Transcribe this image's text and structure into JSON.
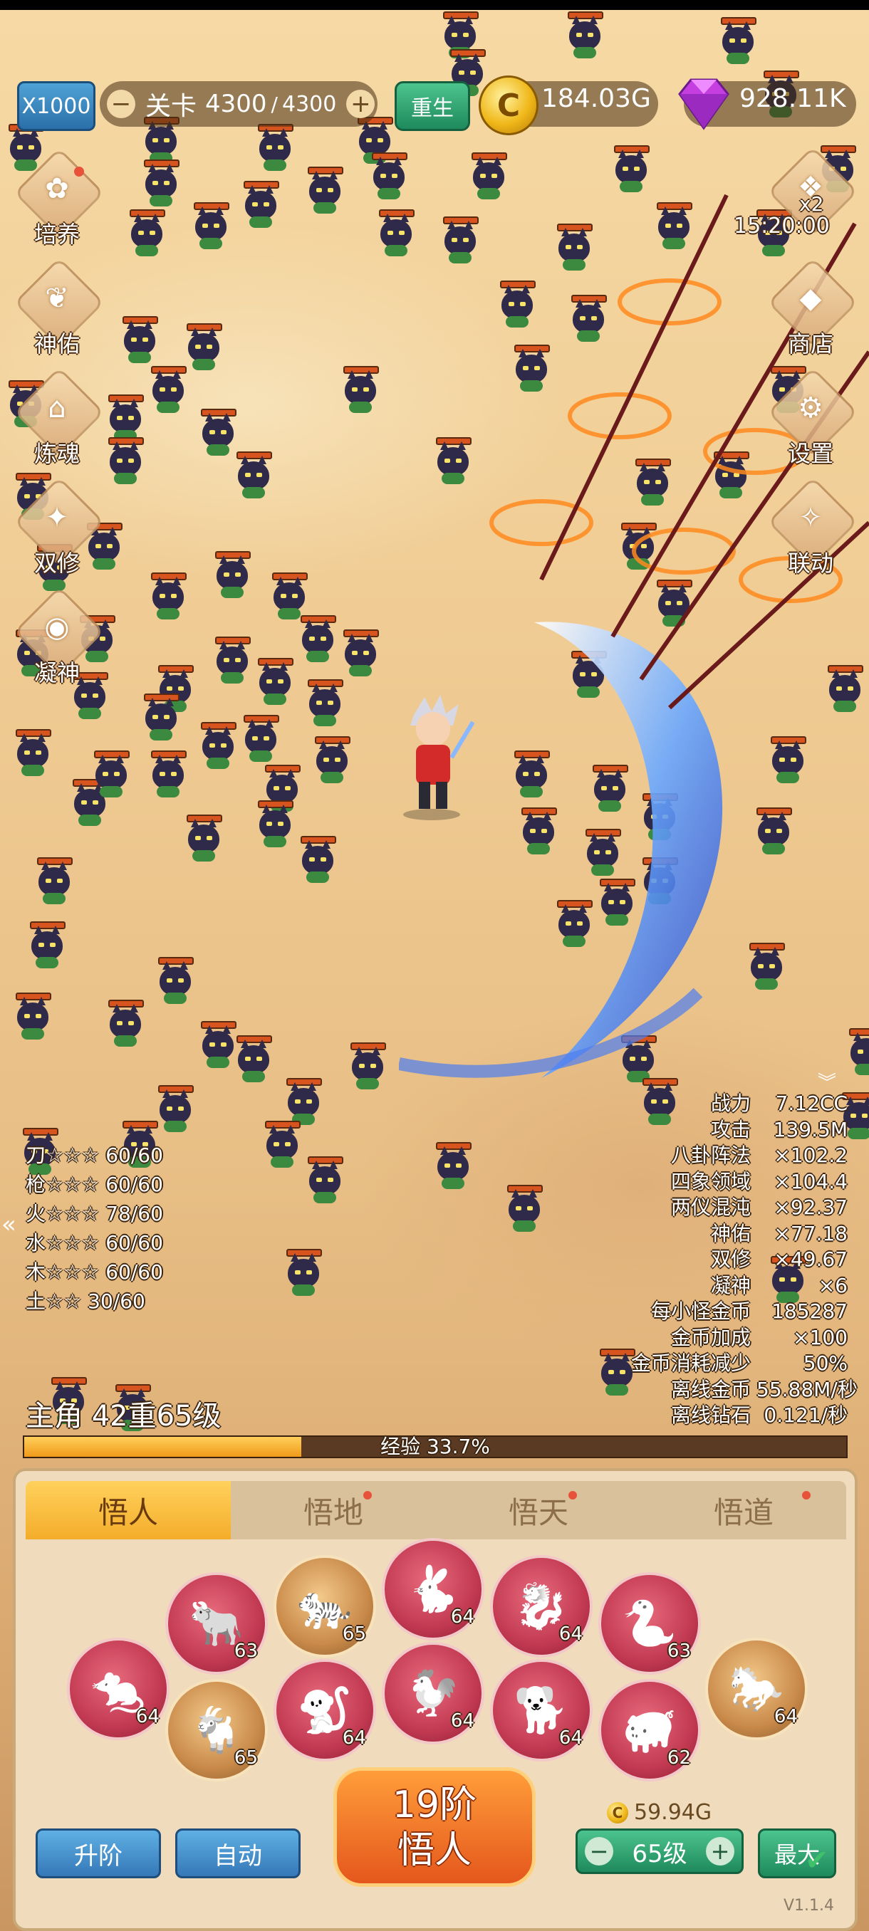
{
  "hud": {
    "speed": "X1000",
    "stage_label": "关卡",
    "stage_current": "4300",
    "stage_sep": "/",
    "stage_max": "4300",
    "minus": "−",
    "plus": "+",
    "rebirth": "重生",
    "gold": "184.03G",
    "gold_coin": "C",
    "gems": "928.11K"
  },
  "side_left": [
    {
      "label": "培养",
      "icon": "flower-icon",
      "glyph": "✿"
    },
    {
      "label": "神佑",
      "icon": "wing-icon",
      "glyph": "❦"
    },
    {
      "label": "炼魂",
      "icon": "house-icon",
      "glyph": "⌂"
    },
    {
      "label": "双修",
      "icon": "flame-icon",
      "glyph": "✦"
    },
    {
      "label": "凝神",
      "icon": "eye-icon",
      "glyph": "◉"
    }
  ],
  "side_right": [
    {
      "label": "x2",
      "icon": "bag-icon"
    },
    {
      "label": "商店",
      "icon": "gem-shop-icon",
      "glyph": "◆"
    },
    {
      "label": "设置",
      "icon": "gear-icon",
      "glyph": "⚙"
    },
    {
      "label": "联动",
      "icon": "link-icon",
      "glyph": "✧"
    }
  ],
  "timer": "15:20:00",
  "elements": [
    {
      "name": "刀",
      "stars": "☆☆☆",
      "value": "60/60"
    },
    {
      "name": "枪",
      "stars": "☆☆☆",
      "value": "60/60"
    },
    {
      "name": "火",
      "stars": "☆☆☆",
      "value": "78/60"
    },
    {
      "name": "水",
      "stars": "☆☆☆",
      "value": "60/60"
    },
    {
      "name": "木",
      "stars": "☆☆☆",
      "value": "60/60"
    },
    {
      "name": "土",
      "stars": "☆☆",
      "value": "30/60"
    }
  ],
  "stats": [
    {
      "k": "战力",
      "v": "7.12CC"
    },
    {
      "k": "攻击",
      "v": "139.5M"
    },
    {
      "k": "八卦阵法",
      "v": "×102.2"
    },
    {
      "k": "四象领域",
      "v": "×104.4"
    },
    {
      "k": "两仪混沌",
      "v": "×92.37"
    },
    {
      "k": "神佑",
      "v": "×77.18"
    },
    {
      "k": "双修",
      "v": "×49.67"
    },
    {
      "k": "凝神",
      "v": "×6"
    },
    {
      "k": "每小怪金币",
      "v": "185287"
    },
    {
      "k": "金币加成",
      "v": "×100"
    },
    {
      "k": "金币消耗减少",
      "v": "50%"
    },
    {
      "k": "离线金币",
      "v": "55.88M/秒"
    },
    {
      "k": "离线钻石",
      "v": "0.121/秒"
    }
  ],
  "hero": {
    "level_text": "主角  42重65级",
    "exp_text": "经验 33.7%",
    "exp_fraction": 0.337
  },
  "tabs": [
    "悟人",
    "悟地",
    "悟天",
    "悟道"
  ],
  "zodiac": [
    {
      "icon": "rat-icon",
      "glyph": "🐀",
      "level": "64",
      "style": "red"
    },
    {
      "icon": "ox-icon",
      "glyph": "🐂",
      "level": "63",
      "style": "red"
    },
    {
      "icon": "goat-icon",
      "glyph": "🐐",
      "level": "65",
      "style": "gold"
    },
    {
      "icon": "tiger-icon",
      "glyph": "🐅",
      "level": "65",
      "style": "gold"
    },
    {
      "icon": "monkey-icon",
      "glyph": "🐒",
      "level": "64",
      "style": "red"
    },
    {
      "icon": "rabbit-icon",
      "glyph": "🐇",
      "level": "64",
      "style": "red"
    },
    {
      "icon": "rooster-icon",
      "glyph": "🐓",
      "level": "64",
      "style": "red"
    },
    {
      "icon": "dragon-icon",
      "glyph": "🐉",
      "level": "64",
      "style": "red"
    },
    {
      "icon": "dog-icon",
      "glyph": "🐕",
      "level": "64",
      "style": "red"
    },
    {
      "icon": "snake-icon",
      "glyph": "🐍",
      "level": "63",
      "style": "red"
    },
    {
      "icon": "pig-icon",
      "glyph": "🐖",
      "level": "62",
      "style": "red"
    },
    {
      "icon": "horse-icon",
      "glyph": "🐎",
      "level": "64",
      "style": "gold"
    }
  ],
  "bottom": {
    "upgrade": "升阶",
    "auto": "自动",
    "main_line1": "19阶",
    "main_line2": "悟人",
    "cost": "59.94G",
    "level": "65级",
    "max": "最大",
    "version": "V1.1.4"
  },
  "colors": {
    "sand": "#f0cd95",
    "accent_orange": "#e4571c",
    "panel": "#f0dcbc",
    "green_button": "#1f8a5c",
    "blue_button": "#3578b8"
  }
}
